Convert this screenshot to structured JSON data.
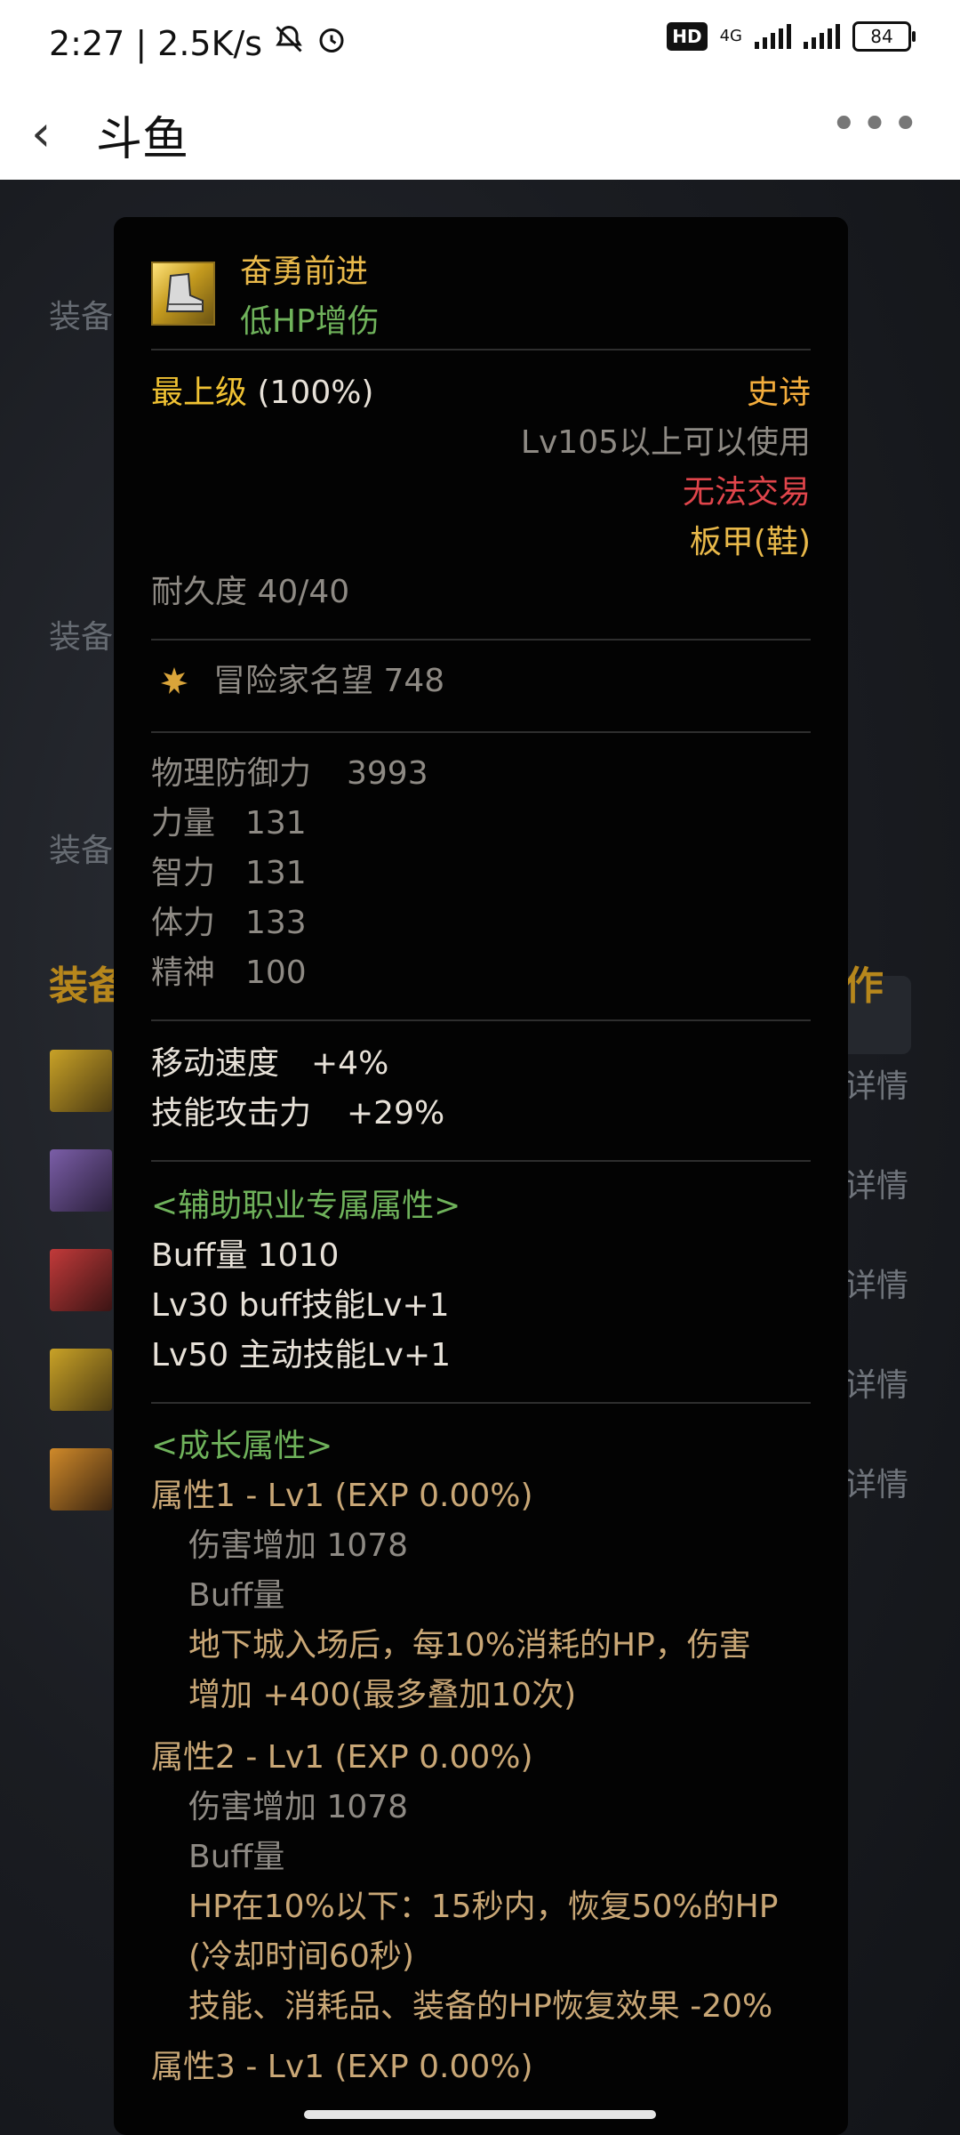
{
  "status": {
    "time": "2:27",
    "speed": "2.5K/s",
    "hd": "HD",
    "network": "4G",
    "battery": "84"
  },
  "header": {
    "title": "斗鱼"
  },
  "background": {
    "left_labels": [
      "装备",
      "装备",
      "装备"
    ],
    "section_title": "装备",
    "right_title": "作",
    "detail_labels": [
      "详情",
      "详情",
      "详情",
      "详情",
      "详情"
    ]
  },
  "item": {
    "name": "奋勇前进",
    "subtitle": "低HP增伤",
    "grade": "最上级",
    "grade_pct": "(100%)",
    "rarity": "史诗",
    "level_req": "Lv105以上可以使用",
    "trade": "无法交易",
    "type": "板甲(鞋)",
    "durability": "耐久度 40/40",
    "fame": "冒险家名望 748",
    "stats": [
      {
        "name": "物理防御力",
        "value": "3993"
      },
      {
        "name": "力量",
        "value": "131"
      },
      {
        "name": "智力",
        "value": "131"
      },
      {
        "name": "体力",
        "value": "133"
      },
      {
        "name": "精神",
        "value": "100"
      }
    ],
    "bonus": [
      {
        "name": "移动速度",
        "value": "+4%"
      },
      {
        "name": "技能攻击力",
        "value": "+29%"
      }
    ],
    "support_header": "<辅助职业专属属性>",
    "support": [
      "Buff量   1010",
      "Lv30 buff技能Lv+1",
      "Lv50 主动技能Lv+1"
    ],
    "growth_header": "<成长属性>",
    "growth": [
      {
        "title": "属性1 - Lv1 (EXP 0.00%)",
        "damage": "伤害增加   1078",
        "buff": "Buff量",
        "desc": [
          "地下城入场后，每10%消耗的HP，伤害",
          "增加 +400(最多叠加10次)"
        ]
      },
      {
        "title": "属性2 - Lv1 (EXP 0.00%)",
        "damage": "伤害增加   1078",
        "buff": "Buff量",
        "desc": [
          "HP在10%以下：15秒内，恢复50%的HP",
          "(冷却时间60秒)",
          "技能、消耗品、装备的HP恢复效果 -20%"
        ]
      },
      {
        "title": "属性3 - Lv1 (EXP 0.00%)"
      }
    ]
  },
  "colors": {
    "gold": "#e9b94a",
    "green": "#6fb25b",
    "red": "#e0454b",
    "orange": "#f4ad3c",
    "tan": "#c9a776"
  }
}
